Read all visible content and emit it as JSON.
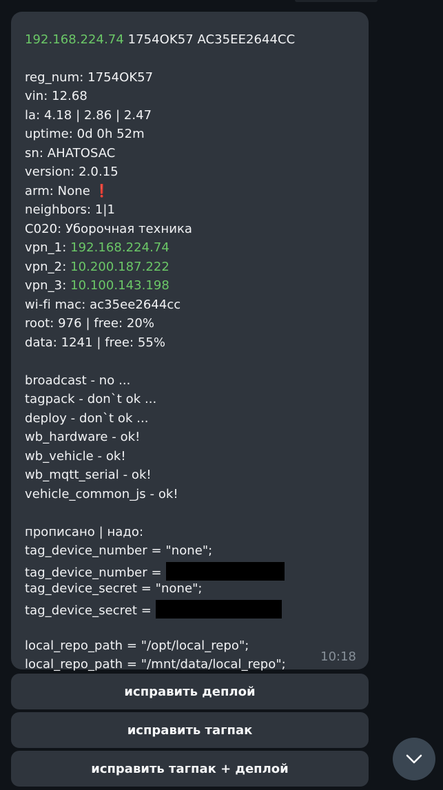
{
  "message": {
    "header": {
      "ip": "192.168.224.74",
      "rest": " 1754OK57 AC35EE2644CC"
    },
    "lines": {
      "reg_num": "reg_num: 1754OK57",
      "vin": "vin: 12.68",
      "la": "la: 4.18 | 2.86 | 2.47",
      "uptime": "uptime: 0d 0h 52m",
      "sn": "sn: AHATOSAC",
      "version": "version: 2.0.15",
      "arm": "arm: None",
      "arm_alert": "❗",
      "neighbors": "neighbors: 1|1",
      "c020": "С020: Уборочная техника",
      "vpn_1_label": "vpn_1: ",
      "vpn_1_ip": "192.168.224.74",
      "vpn_2_label": "vpn_2: ",
      "vpn_2_ip": "10.200.187.222",
      "vpn_3_label": "vpn_3: ",
      "vpn_3_ip": "10.100.143.198",
      "wifi_mac": "wi-fi mac: ac35ee2644cc",
      "root": "root: 976 | free: 20%",
      "data": "data: 1241 | free: 55%",
      "broadcast": "broadcast - no ...",
      "tagpack": "tagpack - don`t ok ...",
      "deploy": "deploy - don`t ok ...",
      "wb_hardware": "wb_hardware - ok!",
      "wb_vehicle": "wb_vehicle - ok!",
      "wb_mqtt_serial": "wb_mqtt_serial - ok!",
      "vehicle_common_js": "vehicle_common_js - ok!",
      "propisano": "прописано | надо:",
      "tag_number_1": "tag_device_number = \"none\";",
      "tag_number_2": "tag_device_number =",
      "tag_secret_1": "tag_device_secret = \"none\";",
      "tag_secret_2": "tag_device_secret =",
      "repo_1": "local_repo_path = \"/opt/local_repo\";",
      "repo_2": "local_repo_path = \"/mnt/data/local_repo\";"
    },
    "time": "10:18"
  },
  "buttons": {
    "fix_deploy": "исправить деплой",
    "fix_tagpack": "исправить тагпак",
    "fix_both": "исправить тагпак + деплой"
  },
  "icons": {
    "scroll_down": "chevron-down-icon",
    "alert": "exclamation-icon"
  },
  "colors": {
    "background": "#0f1318",
    "bubble": "#2f353d",
    "ip_green": "#6bc767",
    "alert_red": "#e53935",
    "time_gray": "#868f98"
  }
}
